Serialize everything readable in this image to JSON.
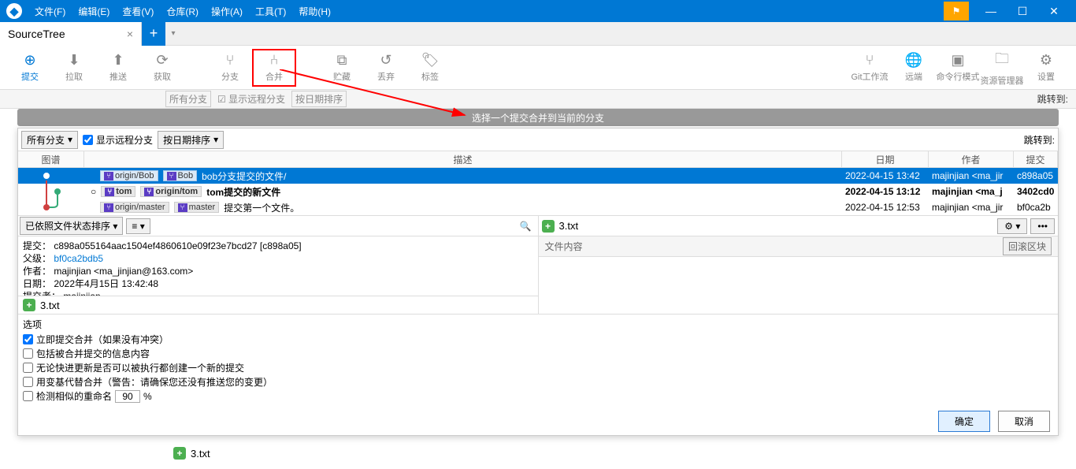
{
  "menu": {
    "file": "文件(F)",
    "edit": "编辑(E)",
    "view": "查看(V)",
    "repo": "仓库(R)",
    "action": "操作(A)",
    "tools": "工具(T)",
    "help": "帮助(H)"
  },
  "tab": {
    "title": "SourceTree",
    "close": "×",
    "add": "+",
    "dd": "▾"
  },
  "toolbar": {
    "commit": "提交",
    "pull": "拉取",
    "push": "推送",
    "fetch": "获取",
    "branch": "分支",
    "merge": "合并",
    "stash": "贮藏",
    "discard": "丢弃",
    "tag": "标签",
    "gitflow": "Git工作流",
    "remote": "远端",
    "terminal": "命令行模式",
    "explorer": "资源管理器",
    "settings": "设置"
  },
  "hidden": {
    "allbranch": "所有分支",
    "showremote": "显示远程分支",
    "sortdate": "按日期排序",
    "jump": "跳转到:"
  },
  "banner": "选择一个提交合并到当前的分支",
  "filter": {
    "allbranch": "所有分支",
    "showremote": "显示远程分支",
    "sortdate": "按日期排序",
    "jump": "跳转到:"
  },
  "cols": {
    "graph": "图谱",
    "desc": "描述",
    "date": "日期",
    "author": "作者",
    "commit": "提交"
  },
  "commits": [
    {
      "tags": [
        "origin/Bob",
        "Bob"
      ],
      "msg": "bob分支提交的文件/",
      "date": "2022-04-15 13:42",
      "author": "majinjian <ma_jir",
      "hash": "c898a05",
      "sel": true
    },
    {
      "tags": [
        "tom",
        "origin/tom"
      ],
      "msg": "tom提交的新文件",
      "date": "2022-04-15 13:12",
      "author": "majinjian <ma_j",
      "hash": "3402cd0",
      "bold": true,
      "dot": true
    },
    {
      "tags": [
        "origin/master",
        "master"
      ],
      "msg": "提交第一个文件。",
      "date": "2022-04-15 12:53",
      "author": "majinjian <ma_jir",
      "hash": "bf0ca2b"
    }
  ],
  "sort": "已依照文件状态排序",
  "listmode": "≡",
  "meta": {
    "l1": "提交： c898a055164aac1504ef4860610e09f23e7bcd27 [c898a05]",
    "l2a": "父级： ",
    "l2b": "bf0ca2bdb5",
    "l3": "作者： majinjian <ma_jinjian@163.com>",
    "l4": "日期： 2022年4月15日 13:42:48",
    "l5": "提交者： majinjian"
  },
  "file": "3.txt",
  "fcHeader": "文件内容",
  "rollback": "回滚区块",
  "options": {
    "title": "选项",
    "o1": "立即提交合并（如果没有冲突）",
    "o2": "包括被合并提交的信息内容",
    "o3": "无论快进更新是否可以被执行都创建一个新的提交",
    "o4": "用变基代替合并（警告：请确保您还没有推送您的变更）",
    "o5": "检测相似的重命名",
    "pct": "90",
    "pctLabel": "%"
  },
  "btns": {
    "ok": "确定",
    "cancel": "取消"
  },
  "bgfile": "3.txt"
}
